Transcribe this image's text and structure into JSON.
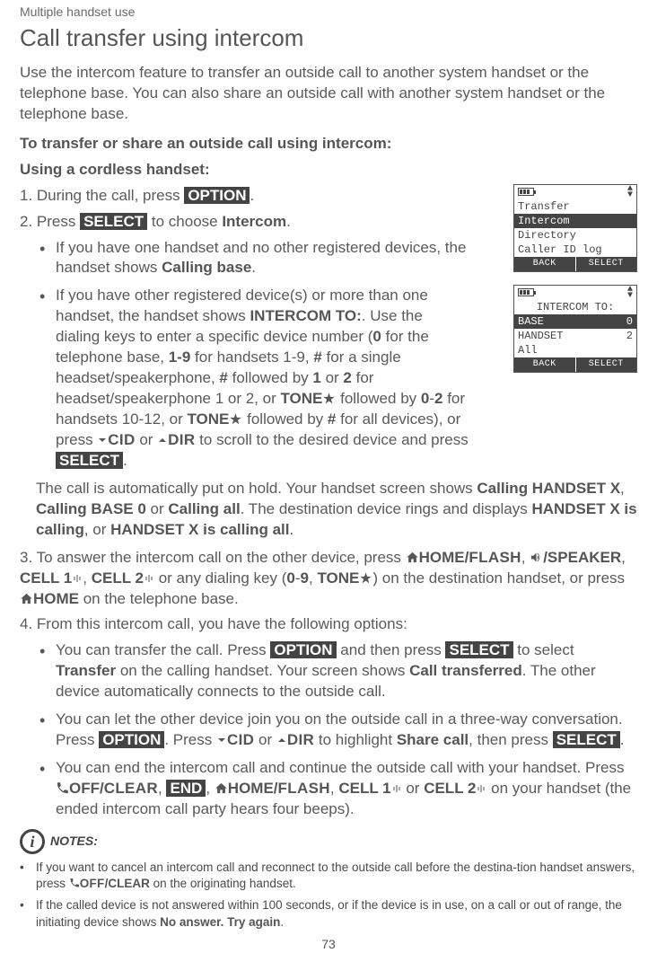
{
  "header": "Multiple handset use",
  "title": "Call transfer using intercom",
  "intro": "Use the intercom feature to transfer an outside call to another system handset or the telephone base. You can also share an outside call with another system handset or the telephone base.",
  "section_a": "To transfer or share an outside call using intercom:",
  "section_b": "Using a cordless handset:",
  "step1_pre": "1. During the call, press ",
  "step1_btn": "OPTION",
  "step1_post": ".",
  "step2_pre": "2. Press ",
  "step2_btn": "SELECT",
  "step2_mid": " to choose ",
  "step2_b": "Intercom",
  "step2_post": ".",
  "s2b1_a": "If you have one handset and no other registered devices, the handset shows ",
  "s2b1_b": "Calling base",
  "s2b1_c": ".",
  "s2b2_a": "If you have other registered device(s) or more than one handset, the handset shows ",
  "s2b2_b": "INTERCOM TO:",
  "s2b2_c": ". Use the dialing keys to enter a specific device number (",
  "s2b2_d": "0",
  "s2b2_e": " for the telephone base, ",
  "s2b2_f": "1-9",
  "s2b2_g": " for handsets 1-9, ",
  "s2b2_h": "#",
  "s2b2_i": " for a single headset/speakerphone, ",
  "s2b2_j": "#",
  "s2b2_k": " followed by ",
  "s2b2_l": "1",
  "s2b2_m": " or ",
  "s2b2_n": "2",
  "s2b2_o": " for headset/speakerphone 1 or 2, or ",
  "s2b2_p": "TONE",
  "s2b2_q": " followed by ",
  "s2b2_r": "0",
  "s2b2_s": "-",
  "s2b2_t": "2",
  "s2b2_u": " for handsets 10-12, or ",
  "s2b2_v": "TONE",
  "s2b2_w": " followed by ",
  "s2b2_x": "#",
  "s2b2_y": " for all devices), or press ",
  "s2b2_cid": "CID",
  "s2b2_z": " or ",
  "s2b2_dir": "DIR",
  "s2b2_aa": " to scroll to the desired device and press ",
  "s2b2_btn": "SELECT",
  "s2b2_ab": ".",
  "hold_a": "The call is automatically put on hold. Your handset screen shows ",
  "hold_b": "Calling HANDSET X",
  "hold_c": ", ",
  "hold_d": "Calling BASE 0",
  "hold_e": " or ",
  "hold_f": "Calling all",
  "hold_g": ". The destination device rings and displays ",
  "hold_h": "HANDSET X is calling",
  "hold_i": ", or ",
  "hold_j": "HANDSET X is calling all",
  "hold_k": ".",
  "step3_pre": "3. To answer the intercom call on the other device, press ",
  "home_flash": "HOME/",
  "flash_sc": "FLASH",
  "step3_a": ", ",
  "speaker": "/SPEAKER",
  "step3_b": ", ",
  "cell1": "CELL 1",
  "step3_c": ", ",
  "cell2": "CELL 2",
  "step3_d": " or any dialing key (",
  "d0": "0",
  "dash": "-",
  "d9": "9",
  "step3_e": ", ",
  "tone3": "TONE",
  "step3_f": ") on the destination handset, or press ",
  "home_b": "HOME",
  "step3_g": " on the telephone base.",
  "step4": "4. From this intercom call, you have the following options:",
  "s4b1_a": "You can transfer the call. Press ",
  "s4b1_opt": "OPTION",
  "s4b1_b": " and then press ",
  "s4b1_sel": "SELECT",
  "s4b1_c": " to select ",
  "s4b1_d": "Transfer",
  "s4b1_e": " on the calling handset. Your screen shows ",
  "s4b1_f": "Call transferred",
  "s4b1_g": ". The other device automatically connects to the outside call.",
  "s4b2_a": "You can let the other device join you on the outside call in a three-way conversation. Press ",
  "s4b2_opt": "OPTION",
  "s4b2_b": ". Press ",
  "s4b2_cid": "CID",
  "s4b2_c": " or ",
  "s4b2_dir": "DIR",
  "s4b2_d": " to highlight ",
  "s4b2_e": "Share call",
  "s4b2_f": ", then press ",
  "s4b2_sel": "SELECT",
  "s4b2_g": ".",
  "s4b3_a": "You can end the intercom call and continue the outside call with your handset. Press ",
  "off_clear": "OFF/",
  "clear_sc": "CLEAR",
  "s4b3_b": ", ",
  "end_btn": "END",
  "s4b3_c": ", ",
  "s4b3_d": ", ",
  "s4b3_e": " or ",
  "s4b3_f": " on your handset (the ended intercom call party hears four beeps).",
  "notes_label": "NOTES:",
  "note1_a": "If you want to cancel an intercom call and reconnect to the outside call before the destina-tion handset answers, press ",
  "note1_off": "OFF",
  "note1_clear": "/CLEAR",
  "note1_b": " on the originating handset.",
  "note2": "If the called device is not answered within 100 seconds, or if the device is in use, on a call or out of range, the initiating device shows ",
  "note2_b": "No answer. Try again",
  "note2_c": ".",
  "page": "73",
  "lcd1": {
    "r1": "Transfer",
    "r2": "Intercom",
    "r3": "Directory",
    "r4": "Caller ID log",
    "back": "BACK",
    "select": "SELECT"
  },
  "lcd2": {
    "title": "INTERCOM TO:",
    "r1a": "BASE",
    "r1b": "0",
    "r2a": "HANDSET",
    "r2b": "2",
    "r3": "All",
    "back": "BACK",
    "select": "SELECT"
  }
}
